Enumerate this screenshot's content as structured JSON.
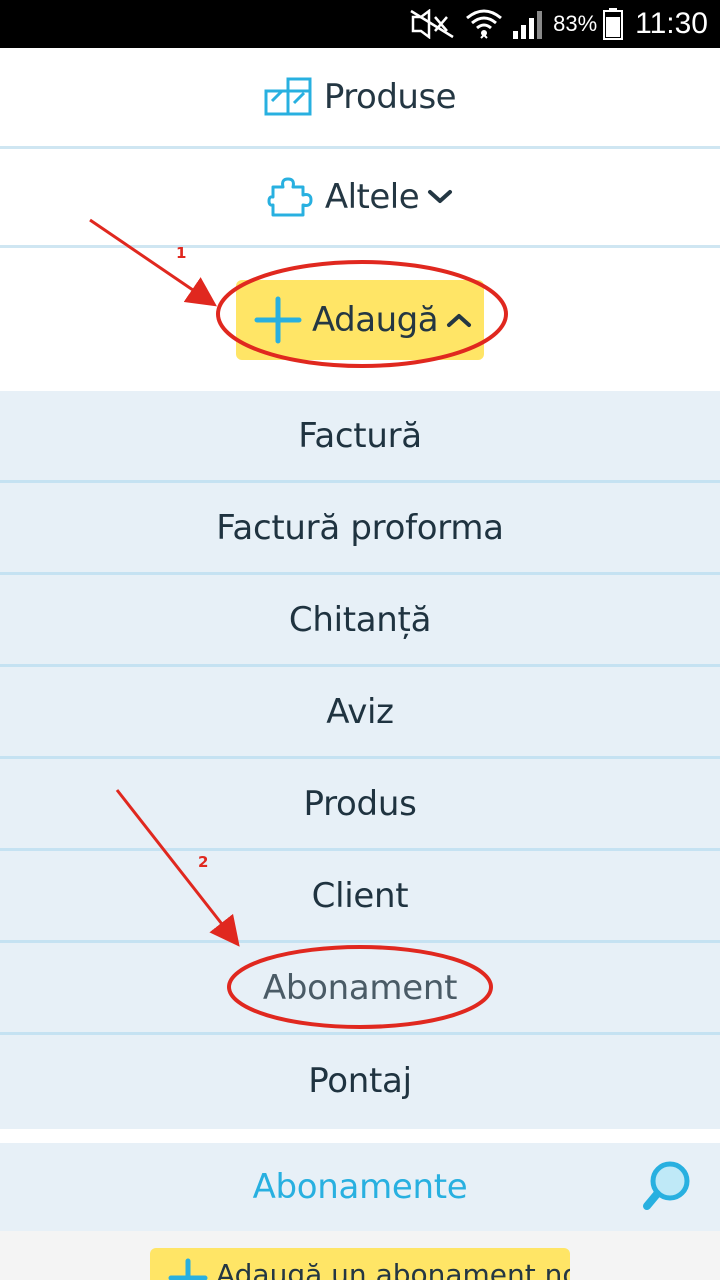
{
  "status_bar": {
    "battery_percent": "83%",
    "time": "11:30",
    "icons": [
      "mute-icon",
      "wifi-icon",
      "signal-icon",
      "battery-icon"
    ]
  },
  "menu": {
    "produse_label": "Produse",
    "altele_label": "Altele",
    "add_label": "Adaugă"
  },
  "dropdown_items": [
    {
      "label": "Factură"
    },
    {
      "label": "Factură proforma"
    },
    {
      "label": "Chitanță"
    },
    {
      "label": "Aviz"
    },
    {
      "label": "Produs"
    },
    {
      "label": "Client"
    },
    {
      "label": "Abonament"
    },
    {
      "label": "Pontaj"
    }
  ],
  "section": {
    "title": "Abonamente",
    "new_button_label": "Adaugă un abonament nou"
  },
  "annotations": {
    "marker_1": "1",
    "marker_2": "2"
  },
  "colors": {
    "accent_blue": "#28b0e0",
    "button_yellow": "#ffe566",
    "annotation_red": "#e0281f",
    "list_background": "#e7f0f7"
  }
}
